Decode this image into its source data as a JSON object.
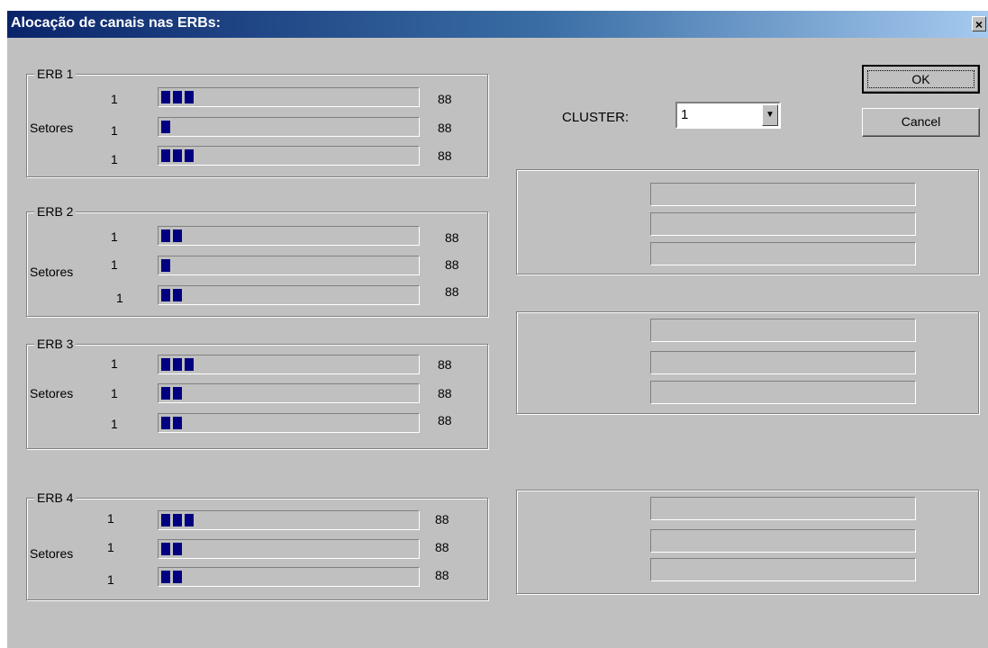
{
  "window": {
    "title": "Alocação de canais nas ERBs:",
    "close_symbol": "×"
  },
  "buttons": {
    "ok": "OK",
    "cancel": "Cancel"
  },
  "cluster": {
    "label": "CLUSTER:",
    "value": "1"
  },
  "sector_label": "Setores",
  "erbs": [
    {
      "name": "ERB 1",
      "sectors": [
        {
          "count": "1",
          "value": "88",
          "blocks": 3
        },
        {
          "count": "1",
          "value": "88",
          "blocks": 1
        },
        {
          "count": "1",
          "value": "88",
          "blocks": 3
        }
      ]
    },
    {
      "name": "ERB 2",
      "sectors": [
        {
          "count": "1",
          "value": "88",
          "blocks": 2
        },
        {
          "count": "1",
          "value": "88",
          "blocks": 1
        },
        {
          "count": "1",
          "value": "88",
          "blocks": 2
        }
      ]
    },
    {
      "name": "ERB 3",
      "sectors": [
        {
          "count": "1",
          "value": "88",
          "blocks": 3
        },
        {
          "count": "1",
          "value": "88",
          "blocks": 2
        },
        {
          "count": "1",
          "value": "88",
          "blocks": 2
        }
      ]
    },
    {
      "name": "ERB 4",
      "sectors": [
        {
          "count": "1",
          "value": "88",
          "blocks": 3
        },
        {
          "count": "1",
          "value": "88",
          "blocks": 2
        },
        {
          "count": "1",
          "value": "88",
          "blocks": 2
        }
      ]
    }
  ],
  "colors": {
    "progress_fill": "#000080",
    "title_start": "#0a246a",
    "dialog_bg": "#c0c0c0"
  },
  "icons": {
    "close": "close-icon",
    "dropdown": "chevron-down-icon"
  }
}
